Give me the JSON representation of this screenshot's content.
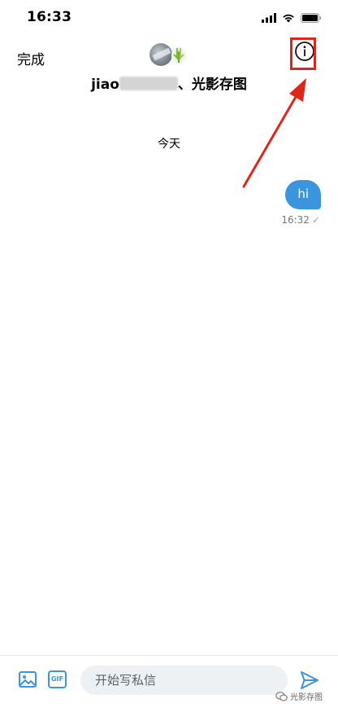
{
  "status_bar": {
    "time": "16:33",
    "icons": [
      "cellular-signal-icon",
      "wifi-icon",
      "battery-icon"
    ]
  },
  "nav": {
    "done_label": "完成",
    "title_prefix": "jiao",
    "title_suffix": "、光影存图",
    "info_icon": "info-icon",
    "highlight_color": "#e0261b"
  },
  "conversation": {
    "date_separator": "今天",
    "messages": [
      {
        "text": "hi",
        "time": "16:32",
        "status": "✓",
        "direction": "outgoing"
      }
    ]
  },
  "composer": {
    "image_icon": "image-icon",
    "gif_label": "GIF",
    "placeholder": "开始写私信",
    "send_icon": "send-icon"
  },
  "watermark": {
    "text": "光影存图"
  },
  "colors": {
    "accent": "#3b95de",
    "annotation": "#e0261b"
  }
}
